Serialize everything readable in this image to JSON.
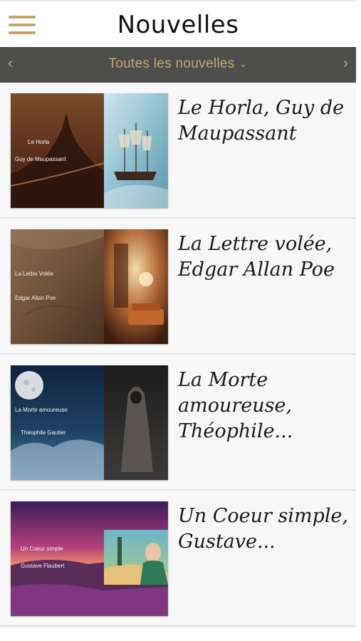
{
  "header": {
    "title": "Nouvelles",
    "menu_icon": "hamburger-icon"
  },
  "filter": {
    "prev_icon": "‹",
    "next_icon": "›",
    "label": "Toutes les nouvelles",
    "chevron": "⌄"
  },
  "colors": {
    "accent": "#c6a56e",
    "filterbar": "#4d4d4b",
    "background": "#f7f7f7"
  },
  "items": [
    {
      "title": "Le Horla, Guy de Maupassant",
      "cover_line1": "Le Horla",
      "cover_line2": "Guy de Maupassant"
    },
    {
      "title": "La Lettre volée, Edgar Allan Poe",
      "cover_line1": "La Lettre Volée",
      "cover_line2": "Edgar Allan Poe"
    },
    {
      "title": "La Morte amoureuse, Théophile...",
      "cover_line1": "La Morte amoureuse",
      "cover_line2": "Théophile Gautier"
    },
    {
      "title": "Un Coeur simple, Gustave...",
      "cover_line1": "Un Coeur simple",
      "cover_line2": "Gustave Flaubert"
    }
  ]
}
